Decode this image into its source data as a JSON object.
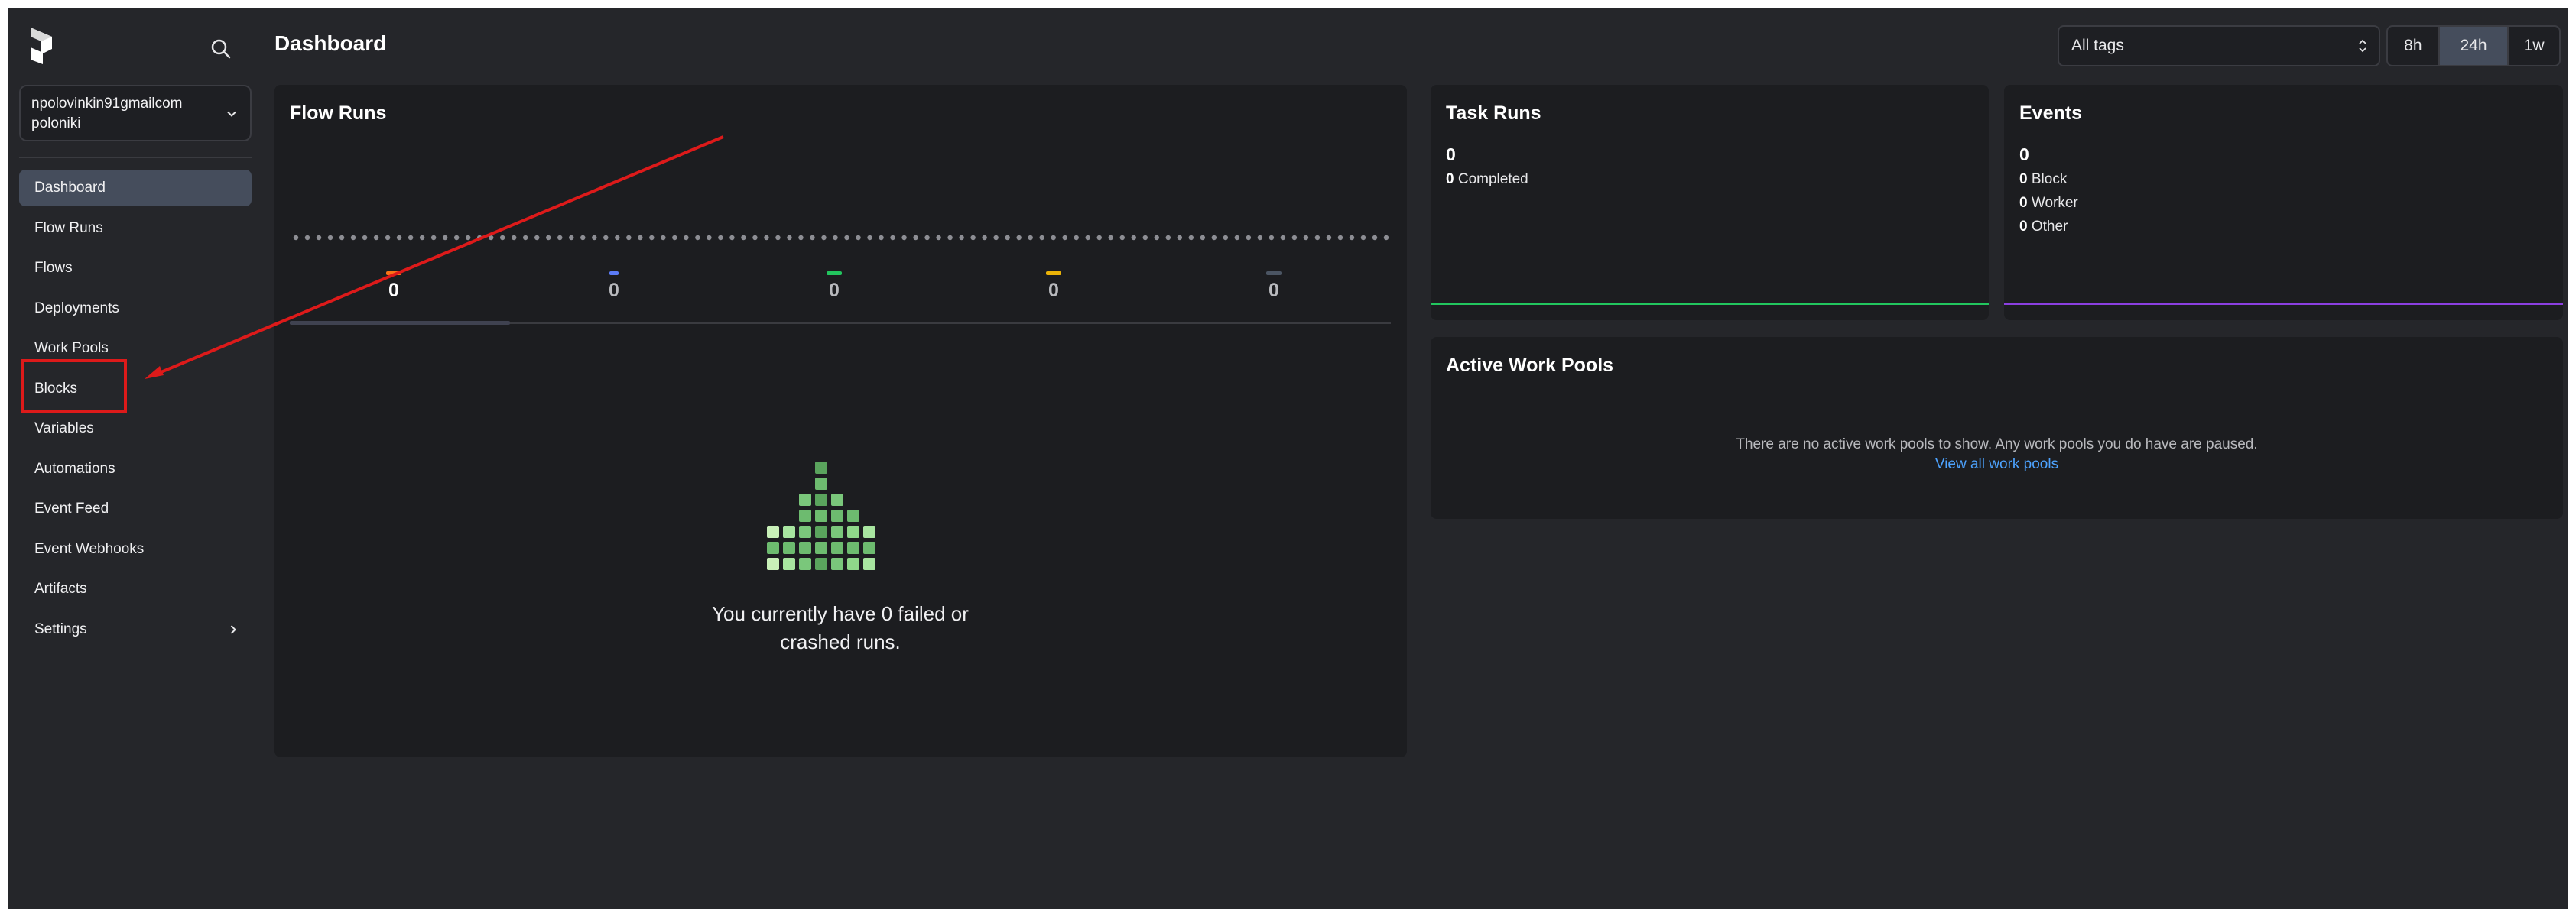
{
  "workspace": {
    "line1": "npolovinkin91gmailcom",
    "line2": "poloniki"
  },
  "nav": [
    {
      "label": "Dashboard",
      "active": true
    },
    {
      "label": "Flow Runs"
    },
    {
      "label": "Flows"
    },
    {
      "label": "Deployments"
    },
    {
      "label": "Work Pools"
    },
    {
      "label": "Blocks"
    },
    {
      "label": "Variables"
    },
    {
      "label": "Automations"
    },
    {
      "label": "Event Feed"
    },
    {
      "label": "Event Webhooks"
    },
    {
      "label": "Artifacts"
    },
    {
      "label": "Settings",
      "has_chevron": true
    }
  ],
  "header": {
    "title": "Dashboard",
    "tags_filter": "All tags",
    "ranges": [
      "8h",
      "24h",
      "1w"
    ],
    "selected_range": "24h"
  },
  "flow_runs": {
    "title": "Flow Runs",
    "states": [
      {
        "count": "0",
        "color": "#f97316"
      },
      {
        "count": "0",
        "color": "#5b7cf7"
      },
      {
        "count": "0",
        "color": "#22c55e"
      },
      {
        "count": "0",
        "color": "#eab308"
      },
      {
        "count": "0",
        "color": "#6b7280"
      }
    ],
    "empty_message_line1": "You currently have 0 failed or",
    "empty_message_line2": "crashed runs."
  },
  "task_runs": {
    "title": "Task Runs",
    "total": "0",
    "completed_count": "0",
    "completed_label": "Completed",
    "line_color": "#22c55e"
  },
  "events": {
    "title": "Events",
    "total": "0",
    "rows": [
      {
        "count": "0",
        "label": "Block"
      },
      {
        "count": "0",
        "label": "Worker"
      },
      {
        "count": "0",
        "label": "Other"
      }
    ],
    "line_color": "#8b3fe0"
  },
  "work_pools": {
    "title": "Active Work Pools",
    "message": "There are no active work pools to show. Any work pools you do have are paused.",
    "link": "View all work pools"
  },
  "colors": {
    "annotation": "#dd1a1a",
    "accent_link": "#4da3ff",
    "empty_art": "#7ac77b"
  }
}
